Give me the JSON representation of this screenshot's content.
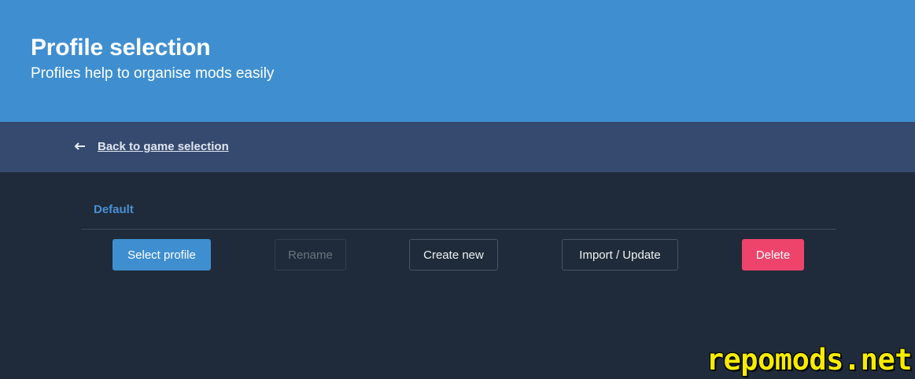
{
  "hero": {
    "title": "Profile selection",
    "subtitle": "Profiles help to organise mods easily",
    "background_color": "#3f8fd0"
  },
  "nav": {
    "back_icon": "arrow-left-icon",
    "back_label": "Back to game selection",
    "background_color": "#364a6f"
  },
  "profiles": {
    "items": [
      {
        "name": "Default"
      }
    ],
    "accent_color": "#4a90d4"
  },
  "actions": {
    "select_label": "Select profile",
    "rename_label": "Rename",
    "create_label": "Create new",
    "import_label": "Import / Update",
    "delete_label": "Delete",
    "primary_color": "#3f8fd0",
    "danger_color": "#ee446b"
  },
  "watermark": {
    "text": "repomods.net",
    "color": "#f5ec00"
  },
  "theme": {
    "background_color": "#1f2b3a"
  }
}
